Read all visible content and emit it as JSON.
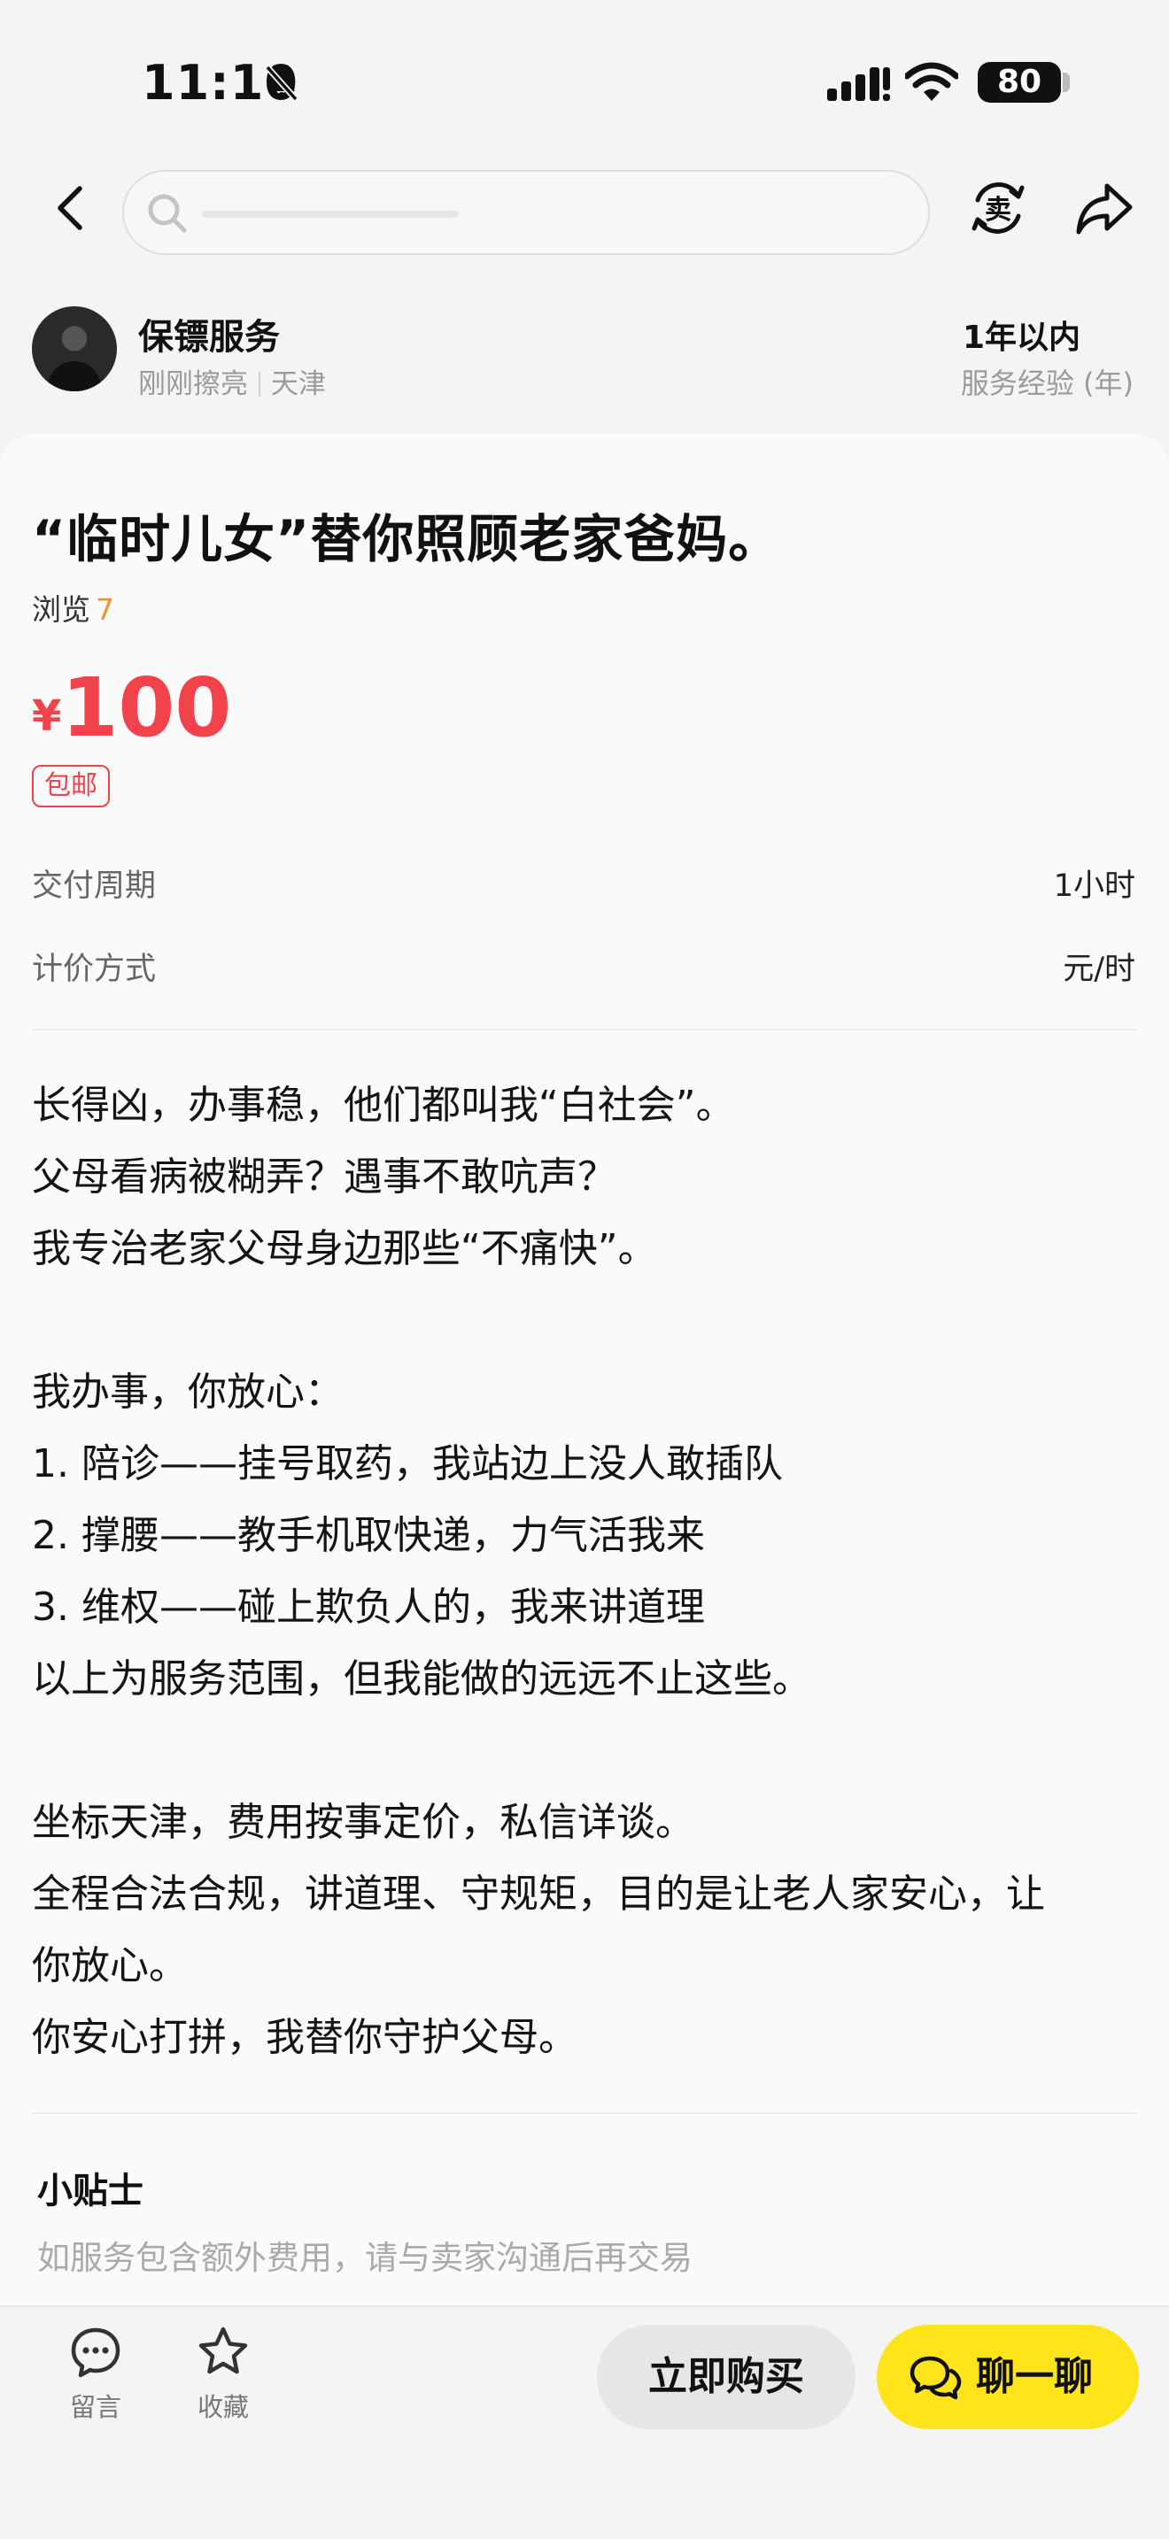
{
  "status_bar": {
    "time": "11:10",
    "battery": "80"
  },
  "seller": {
    "name": "保镖服务",
    "status": "刚刚擦亮",
    "location": "天津",
    "experience_value": "1年以内",
    "experience_label": "服务经验 (年)"
  },
  "listing": {
    "title": "“临时儿女”替你照顾老家爸妈。",
    "views_label": "浏览",
    "views_count": "7",
    "price_symbol": "¥",
    "price_value": "100",
    "shipping_tag": "包邮",
    "attributes": [
      {
        "label": "交付周期",
        "value": "1小时"
      },
      {
        "label": "计价方式",
        "value": "元/时"
      }
    ],
    "description_lines": [
      "长得凶，办事稳，他们都叫我“白社会”。",
      "父母看病被糊弄？遇事不敢吭声？",
      "我专治老家父母身边那些“不痛快”。",
      "",
      "我办事，你放心：",
      "1. 陪诊——挂号取药，我站边上没人敢插队",
      "2. 撑腰——教手机取快递，力气活我来",
      "3. 维权——碰上欺负人的，我来讲道理",
      "以上为服务范围，但我能做的远远不止这些。",
      "",
      "坐标天津，费用按事定价，私信详谈。",
      "全程合法合规，讲道理、守规矩，目的是让老人家安心，让",
      "你放心。",
      "你安心打拼，我替你守护父母。"
    ]
  },
  "tips": {
    "title": "小贴士",
    "text": "如服务包含额外费用，请与卖家沟通后再交易"
  },
  "bottom_bar": {
    "comment_label": "留言",
    "favorite_label": "收藏",
    "buy_label": "立即购买",
    "chat_label": "聊一聊"
  },
  "icons": {
    "sell": "卖"
  },
  "colors": {
    "price": "#f2434c",
    "views_count": "#e8952b",
    "chat_button": "#ffe419"
  }
}
